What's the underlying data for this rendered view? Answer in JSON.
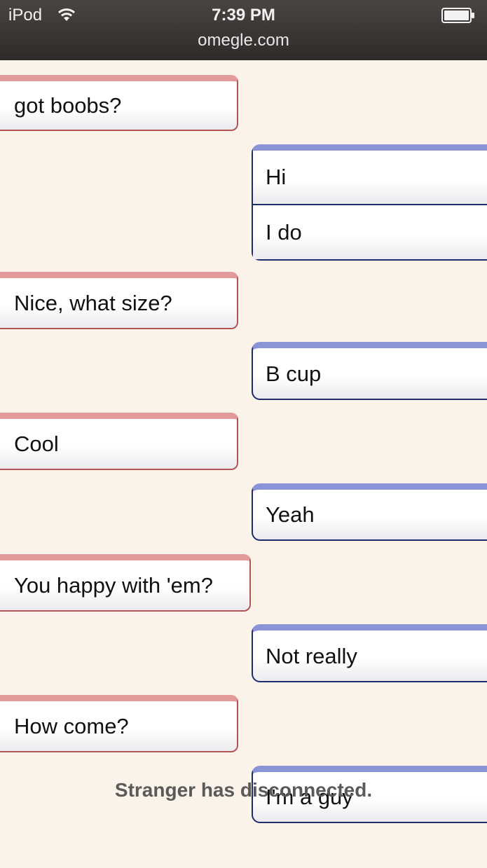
{
  "status_bar": {
    "carrier": "iPod",
    "time": "7:39 PM",
    "url": "omegle.com"
  },
  "chat": {
    "messages": [
      {
        "sender": "you",
        "text": "got boobs?"
      },
      {
        "sender": "stranger",
        "text": "Hi"
      },
      {
        "sender": "stranger",
        "text": "I do"
      },
      {
        "sender": "you",
        "text": "Nice, what size?"
      },
      {
        "sender": "stranger",
        "text": "B cup"
      },
      {
        "sender": "you",
        "text": "Cool"
      },
      {
        "sender": "stranger",
        "text": "Yeah"
      },
      {
        "sender": "you",
        "text": "You happy with 'em?"
      },
      {
        "sender": "stranger",
        "text": "Not really"
      },
      {
        "sender": "you",
        "text": "How come?"
      },
      {
        "sender": "stranger",
        "text": "I'm a guy"
      }
    ],
    "status_message": "Stranger has disconnected."
  },
  "colors": {
    "you_accent": "#e39a9a",
    "you_border": "#b25454",
    "stranger_accent": "#8c94d8",
    "stranger_border": "#1d2d6b",
    "background": "#fbf3ea"
  }
}
